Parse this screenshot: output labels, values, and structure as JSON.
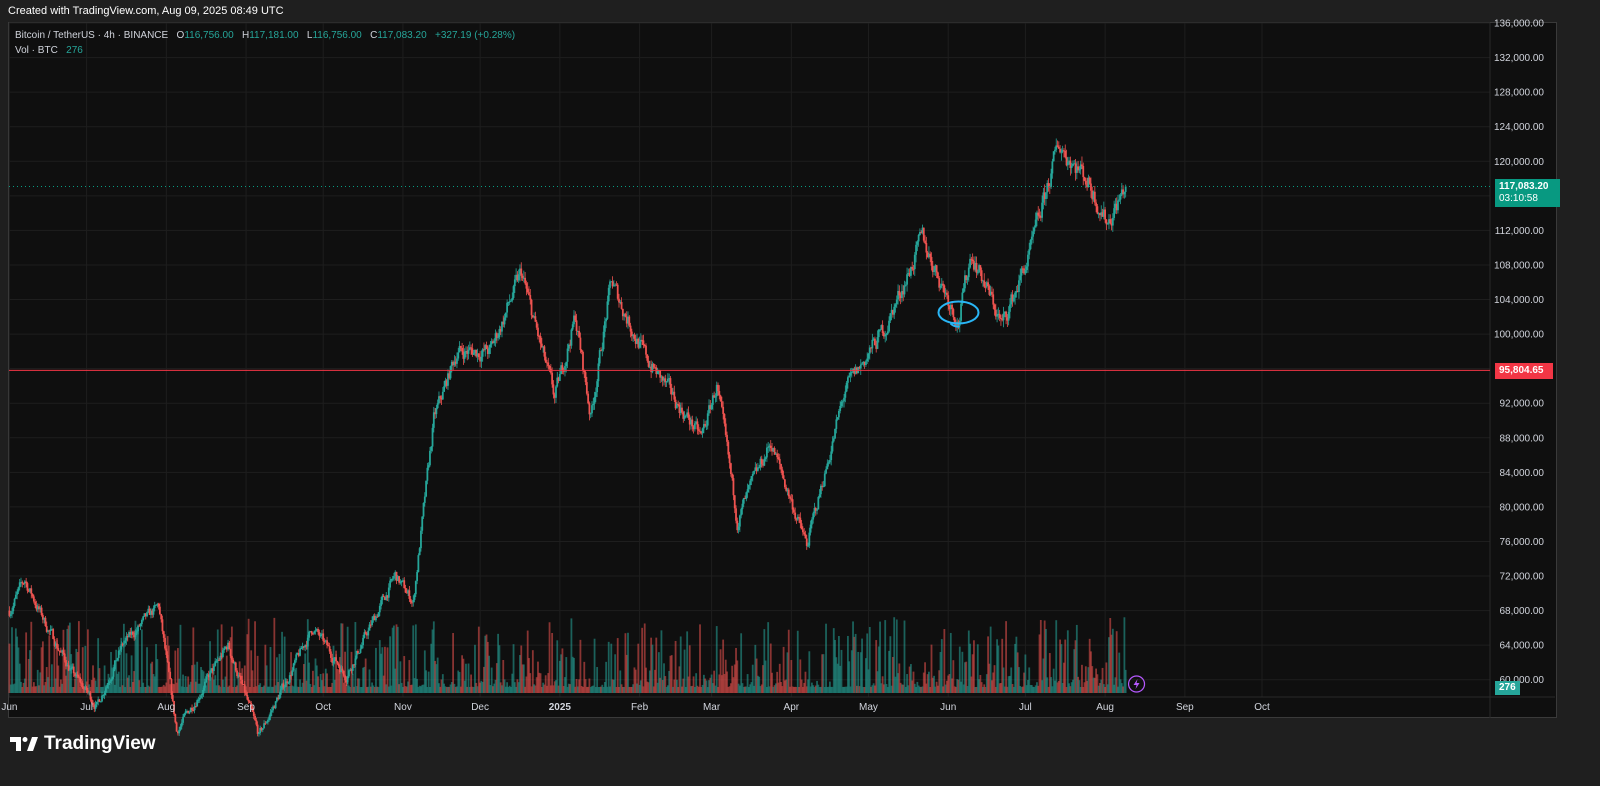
{
  "header": {
    "created_text": "Created with TradingView.com, Aug 09, 2025 08:49 UTC"
  },
  "legend": {
    "symbol": "Bitcoin / TetherUS · 4h · BINANCE",
    "open_label": "O",
    "open": "116,756.00",
    "high_label": "H",
    "high": "117,181.00",
    "low_label": "L",
    "low": "116,756.00",
    "close_label": "C",
    "close": "117,083.20",
    "change": "+327.19 (+0.28%)",
    "vol_label": "Vol · BTC",
    "vol": "276"
  },
  "price_tag": {
    "price": "117,083.20",
    "countdown": "03:10:58",
    "color": "#089981"
  },
  "level_tag": {
    "price": "95,804.65",
    "color": "#f23645"
  },
  "volume_tag": {
    "value": "276"
  },
  "footer": {
    "brand": "TradingView"
  },
  "colors": {
    "up": "#26a69a",
    "down": "#ef5350",
    "grid": "#1e1e1e",
    "annotation": "#29b6f6"
  },
  "chart_data": {
    "type": "candlestick",
    "title": "Bitcoin / TetherUS · 4h · BINANCE",
    "y_axis": {
      "min": 58000,
      "max": 136000,
      "ticks": [
        60000,
        64000,
        68000,
        72000,
        76000,
        80000,
        84000,
        88000,
        92000,
        96000,
        100000,
        104000,
        108000,
        112000,
        116000,
        120000,
        124000,
        128000,
        132000,
        136000
      ],
      "tick_labels": [
        "60,000.00",
        "64,000.00",
        "68,000.00",
        "72,000.00",
        "76,000.00",
        "80,000.00",
        "84,000.00",
        "88,000.00",
        "92,000.00",
        "96,000.00",
        "100,000.00",
        "104,000.00",
        "108,000.00",
        "112,000.00",
        "116,000.00",
        "120,000.00",
        "124,000.00",
        "128,000.00",
        "132,000.00",
        "136,000.00"
      ]
    },
    "x_axis": {
      "labels": [
        "Jun",
        "Jul",
        "Aug",
        "Sep",
        "Oct",
        "Nov",
        "Dec",
        "2025",
        "Feb",
        "Mar",
        "Apr",
        "May",
        "Jun",
        "Jul",
        "Aug",
        "Sep",
        "Oct"
      ],
      "dates": [
        "2024-06-01",
        "2024-07-01",
        "2024-08-01",
        "2024-09-01",
        "2024-10-01",
        "2024-11-01",
        "2024-12-01",
        "2025-01-01",
        "2025-02-01",
        "2025-03-01",
        "2025-04-01",
        "2025-05-01",
        "2025-06-01",
        "2025-07-01",
        "2025-08-01",
        "2025-09-01",
        "2025-10-01"
      ]
    },
    "price_path": {
      "dates": [
        "2024-06-01",
        "2024-06-07",
        "2024-06-15",
        "2024-06-25",
        "2024-07-05",
        "2024-07-15",
        "2024-07-29",
        "2024-08-05",
        "2024-08-25",
        "2024-09-06",
        "2024-09-27",
        "2024-10-10",
        "2024-10-29",
        "2024-11-05",
        "2024-11-13",
        "2024-11-22",
        "2024-12-05",
        "2024-12-17",
        "2024-12-30",
        "2025-01-07",
        "2025-01-13",
        "2025-01-21",
        "2025-02-03",
        "2025-02-25",
        "2025-03-03",
        "2025-03-11",
        "2025-03-24",
        "2025-04-07",
        "2025-04-22",
        "2025-05-08",
        "2025-05-22",
        "2025-06-05",
        "2025-06-10",
        "2025-06-22",
        "2025-07-03",
        "2025-07-14",
        "2025-07-25",
        "2025-08-02",
        "2025-08-09"
      ],
      "close": [
        68000,
        71500,
        66500,
        61000,
        57000,
        64000,
        68500,
        54000,
        64000,
        53500,
        66000,
        60500,
        72000,
        69000,
        90000,
        98000,
        98000,
        107000,
        92500,
        102000,
        90500,
        106000,
        97500,
        88000,
        94000,
        78500,
        87500,
        75500,
        93500,
        101000,
        111000,
        101500,
        109500,
        101000,
        109500,
        122000,
        118000,
        113000,
        117083
      ]
    },
    "reference_line": {
      "price": 95804.65,
      "label": "95,804.65"
    },
    "current_price": 117083.2,
    "annotation": {
      "type": "ellipse",
      "date": "2025-06-05",
      "price": 102500
    }
  }
}
